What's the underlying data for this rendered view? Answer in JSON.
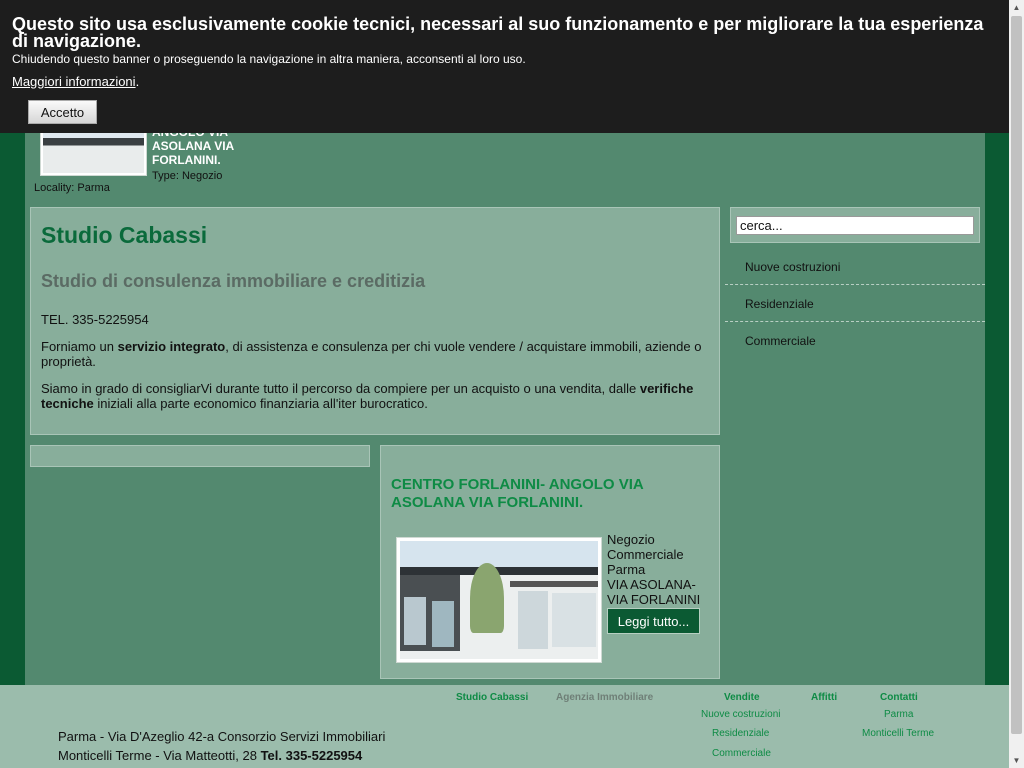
{
  "cookie_banner": {
    "title": "Questo sito usa esclusivamente cookie tecnici, necessari al suo funzionamento e per migliorare la tua esperienza di navigazione.",
    "subtitle": "Chiudendo questo banner o proseguendo la navigazione in altra maniera, acconsenti al loro uso.",
    "more_link": "Maggiori informazioni",
    "more_suffix": ".",
    "accept_button": "Accetto"
  },
  "header_teaser": {
    "title": "ANGOLO VIA ASOLANA VIA FORLANINI.",
    "type": "Type: Negozio",
    "locality": "Locality: Parma"
  },
  "intro": {
    "title": "Studio Cabassi",
    "subtitle": "Studio di consulenza immobiliare e creditizia",
    "tel": "TEL. 335-5225954",
    "p1_a": "Forniamo un ",
    "p1_b": "servizio integrato",
    "p1_c": ", di assistenza e consulenza per chi vuole vendere / acquistare immobili, aziende o proprietà.",
    "p2_a": "Siamo in grado di consigliarVi durante tutto il percorso da compiere per un acquisto o una vendita, dalle ",
    "p2_b": "verifiche tecniche",
    "p2_c": " iniziali alla parte economico finanziaria all'iter burocratico."
  },
  "property": {
    "title": "CENTRO FORLANINI- ANGOLO VIA ASOLANA VIA FORLANINI.",
    "line1": "Negozio",
    "line2": "Commerciale",
    "line3": "Parma",
    "line4": "VIA ASOLANA-",
    "line5": "VIA FORLANINI",
    "read_more": "Leggi tutto..."
  },
  "sidebar": {
    "search_value": "cerca...",
    "items": [
      {
        "label": "Nuove costruzioni"
      },
      {
        "label": "Residenziale"
      },
      {
        "label": "Commerciale"
      }
    ]
  },
  "footer": {
    "address1": "Parma - Via D'Azeglio 42-a Consorzio Servizi Immobiliari",
    "address2_a": "Monticelli Terme - Via Matteotti, 28 ",
    "address2_b": "Tel. 335-5225954",
    "nav_studio": "Studio Cabassi",
    "nav_agenzia": "Agenzia Immobiliare",
    "nav_vendite": "Vendite",
    "nav_vendite_items": [
      "Nuove costruzioni",
      "Residenziale",
      "Commerciale"
    ],
    "nav_affitti": "Affitti",
    "nav_contatti": "Contatti",
    "nav_contatti_items": [
      "Parma",
      "Monticelli Terme"
    ]
  },
  "colors": {
    "page_bg": "#0b5a33",
    "container_bg": "#53896f",
    "panel_bg": "#88ae9b",
    "accent_green": "#0e8b45",
    "footer_bg": "#9bbcac",
    "cookie_bg": "#1d1d1d"
  }
}
